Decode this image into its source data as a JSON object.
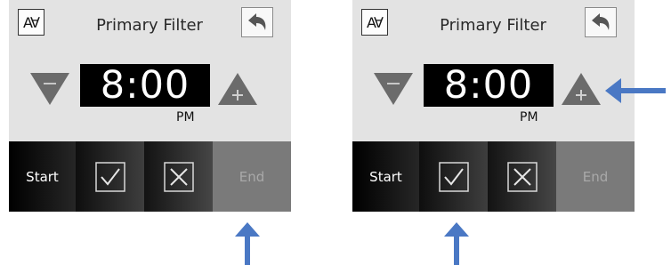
{
  "panels": [
    {
      "font_button": "A∀",
      "title": "Primary Filter",
      "time": "8:00",
      "ampm": "PM",
      "start_label": "Start",
      "end_label": "End"
    },
    {
      "font_button": "A∀",
      "title": "Primary Filter",
      "time": "8:00",
      "ampm": "PM",
      "start_label": "Start",
      "end_label": "End"
    }
  ],
  "colors": {
    "panel_bg": "#e3e3e3",
    "arrow_button": "#6b6b6b",
    "annotation_arrow": "#4a78c4"
  },
  "icons": [
    "font-size-icon",
    "back-icon",
    "decrease-arrow-icon",
    "increase-arrow-icon",
    "checkmark-icon",
    "x-icon",
    "annotation-arrow-icon"
  ]
}
